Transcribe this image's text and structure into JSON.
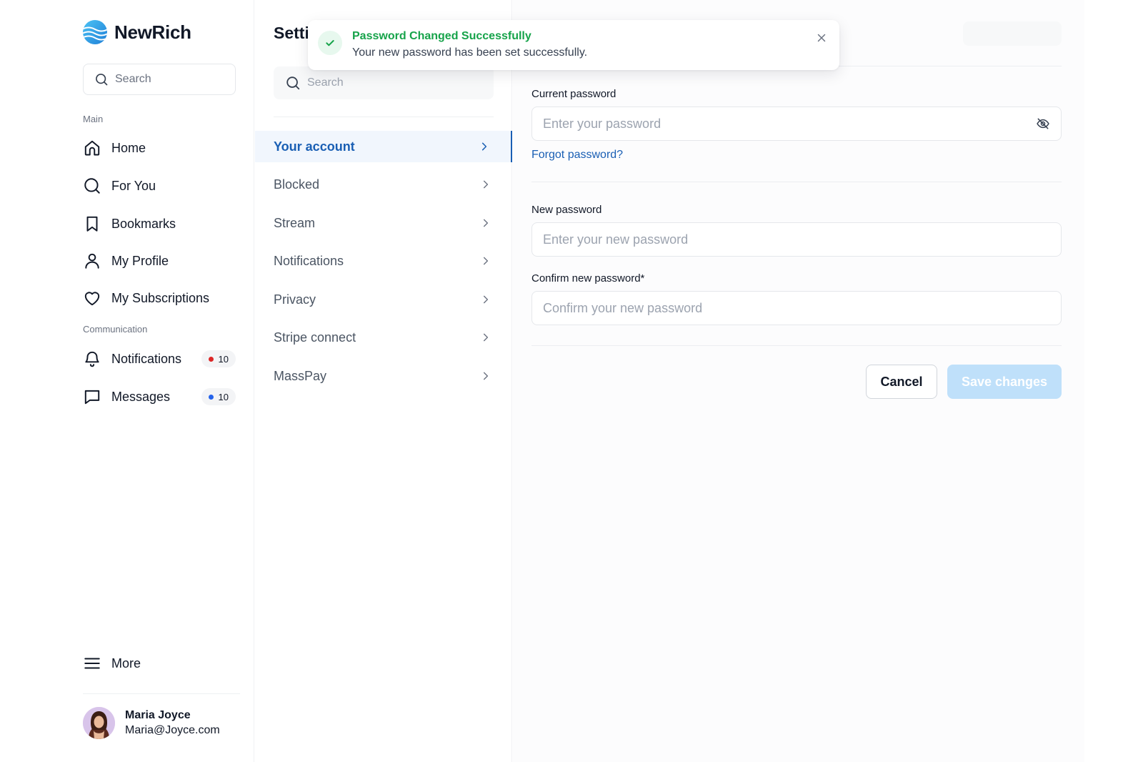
{
  "brand": {
    "name": "NewRich",
    "accent": "#2b9de6"
  },
  "sidebar": {
    "search_placeholder": "Search",
    "section_main": "Main",
    "main_items": [
      {
        "label": "Home",
        "icon": "home-icon"
      },
      {
        "label": "For You",
        "icon": "search-icon"
      },
      {
        "label": "Bookmarks",
        "icon": "bookmark-icon"
      },
      {
        "label": "My Profile",
        "icon": "user-icon"
      },
      {
        "label": "My Subscriptions",
        "icon": "heart-icon"
      }
    ],
    "section_communication": "Communication",
    "comm_items": [
      {
        "label": "Notifications",
        "icon": "bell-icon",
        "badge": "10",
        "badge_dot_color": "#dc2626"
      },
      {
        "label": "Messages",
        "icon": "message-icon",
        "badge": "10",
        "badge_dot_color": "#2563eb"
      }
    ],
    "more_label": "More",
    "user": {
      "name": "Maria Joyce",
      "email": "Maria@Joyce.com"
    }
  },
  "settings": {
    "title": "Setti",
    "search_placeholder": "Search",
    "menu": [
      {
        "label": "Your account",
        "active": true
      },
      {
        "label": "Blocked"
      },
      {
        "label": "Stream"
      },
      {
        "label": "Notifications"
      },
      {
        "label": "Privacy"
      },
      {
        "label": "Stripe connect"
      },
      {
        "label": "MassPay"
      }
    ]
  },
  "form": {
    "current_label": "Current password",
    "current_placeholder": "Enter your password",
    "forgot_link": "Forgot password?",
    "new_label": "New password",
    "new_placeholder": "Enter your new password",
    "confirm_label": "Confirm new password*",
    "confirm_placeholder": "Confirm your new password",
    "cancel_label": "Cancel",
    "save_label": "Save changes"
  },
  "toast": {
    "title": "Password Changed Successfully",
    "message": "Your new password has been set successfully.",
    "color": "#16a34a"
  }
}
